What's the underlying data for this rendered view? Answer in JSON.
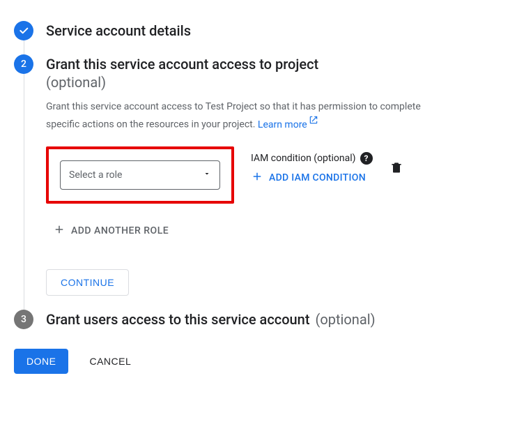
{
  "steps": {
    "one": {
      "title": "Service account details"
    },
    "two": {
      "number": "2",
      "title": "Grant this service account access to project",
      "subtitle": "(optional)",
      "description_pre": "Grant this service account access to Test Project so that it has permission to complete specific actions on the resources in your project. ",
      "learn_more": "Learn more",
      "role_placeholder": "Select a role",
      "iam_label": "IAM condition (optional)",
      "add_iam": "ADD IAM CONDITION",
      "add_role": "ADD ANOTHER ROLE",
      "continue": "CONTINUE"
    },
    "three": {
      "number": "3",
      "title": "Grant users access to this service account",
      "subtitle": "(optional)"
    }
  },
  "footer": {
    "done": "DONE",
    "cancel": "CANCEL"
  }
}
